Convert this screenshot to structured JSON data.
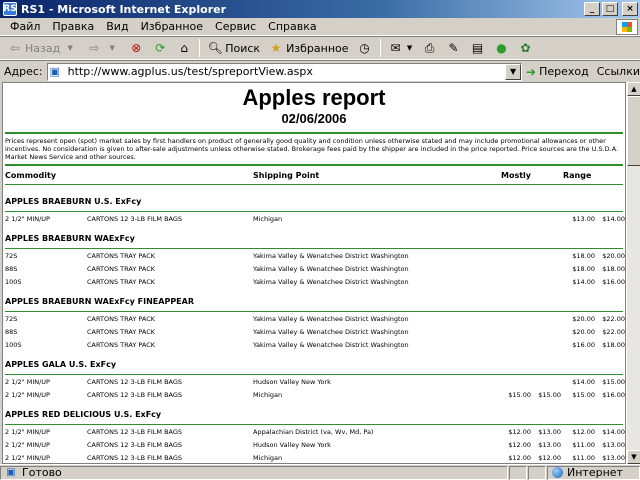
{
  "window": {
    "title": "RS1 - Microsoft Internet Explorer",
    "app_icon": "RS"
  },
  "menu": [
    "Файл",
    "Правка",
    "Вид",
    "Избранное",
    "Сервис",
    "Справка"
  ],
  "toolbar": {
    "back": "Назад",
    "search": "Поиск",
    "favorites": "Избранное"
  },
  "address": {
    "label": "Адрес:",
    "url": "http://www.agplus.us/test/spreportView.aspx",
    "go": "Переход",
    "links": "Ссылки"
  },
  "report": {
    "title": "Apples report",
    "date": "02/06/2006",
    "note": "Prices represent open (spot) market sales by first handlers on product of generally good quality and condition unless otherwise stated and may include promotional allowances or other incentives. No consideration is given to after-sale adjustments unless otherwise stated. Brokerage fees paid by the shipper are included in the price reported. Price sources are the U.S.D.A. Market News Service and other sources.",
    "headers": {
      "commodity": "Commodity",
      "shipping": "Shipping Point",
      "mostly": "Mostly",
      "range": "Range"
    },
    "sections": [
      {
        "title": "APPLES BRAEBURN U.S. ExFcy",
        "rows": [
          {
            "size": "2 1/2\" MIN/UP",
            "pack": "CARTONS 12 3-LB FILM BAGS",
            "ship": "Michigan",
            "m1": "",
            "m2": "",
            "r1": "$13.00",
            "r2": "$14.00"
          }
        ]
      },
      {
        "title": "APPLES BRAEBURN WAExFcy",
        "rows": [
          {
            "size": "72S",
            "pack": "CARTONS TRAY PACK",
            "ship": "Yakima Valley & Wenatchee District Washington",
            "m1": "",
            "m2": "",
            "r1": "$18.00",
            "r2": "$20.00"
          },
          {
            "size": "88S",
            "pack": "CARTONS TRAY PACK",
            "ship": "Yakima Valley & Wenatchee District Washington",
            "m1": "",
            "m2": "",
            "r1": "$18.00",
            "r2": "$18.00"
          },
          {
            "size": "100S",
            "pack": "CARTONS TRAY PACK",
            "ship": "Yakima Valley & Wenatchee District Washington",
            "m1": "",
            "m2": "",
            "r1": "$14.00",
            "r2": "$16.00"
          }
        ]
      },
      {
        "title": "APPLES BRAEBURN WAExFcy FINEAPPEAR",
        "rows": [
          {
            "size": "72S",
            "pack": "CARTONS TRAY PACK",
            "ship": "Yakima Valley & Wenatchee District Washington",
            "m1": "",
            "m2": "",
            "r1": "$20.00",
            "r2": "$22.00"
          },
          {
            "size": "88S",
            "pack": "CARTONS TRAY PACK",
            "ship": "Yakima Valley & Wenatchee District Washington",
            "m1": "",
            "m2": "",
            "r1": "$20.00",
            "r2": "$22.00"
          },
          {
            "size": "100S",
            "pack": "CARTONS TRAY PACK",
            "ship": "Yakima Valley & Wenatchee District Washington",
            "m1": "",
            "m2": "",
            "r1": "$16.00",
            "r2": "$18.00"
          }
        ]
      },
      {
        "title": "APPLES GALA U.S. ExFcy",
        "rows": [
          {
            "size": "2 1/2\" MIN/UP",
            "pack": "CARTONS 12 3-LB FILM BAGS",
            "ship": "Hudson Valley New York",
            "m1": "",
            "m2": "",
            "r1": "$14.00",
            "r2": "$15.00"
          },
          {
            "size": "2 1/2\" MIN/UP",
            "pack": "CARTONS 12 3-LB FILM BAGS",
            "ship": "Michigan",
            "m1": "$15.00",
            "m2": "$15.00",
            "r1": "$15.00",
            "r2": "$16.00"
          }
        ]
      },
      {
        "title": "APPLES RED DELICIOUS U.S. ExFcy",
        "rows": [
          {
            "size": "2 1/2\" MIN/UP",
            "pack": "CARTONS 12 3-LB FILM BAGS",
            "ship": "Appalachian District (va, Wv, Md, Pa)",
            "m1": "$12.00",
            "m2": "$13.00",
            "r1": "$12.00",
            "r2": "$14.00"
          },
          {
            "size": "2 1/2\" MIN/UP",
            "pack": "CARTONS 12 3-LB FILM BAGS",
            "ship": "Hudson Valley New York",
            "m1": "$12.00",
            "m2": "$13.00",
            "r1": "$11.00",
            "r2": "$13.00"
          },
          {
            "size": "2 1/2\" MIN/UP",
            "pack": "CARTONS 12 3-LB FILM BAGS",
            "ship": "Michigan",
            "m1": "$12.00",
            "m2": "$12.00",
            "r1": "$11.00",
            "r2": "$13.00"
          }
        ]
      }
    ]
  },
  "status": {
    "text": "Готово",
    "zone": "Интернет"
  },
  "colors": {
    "titlebar": "#0a246a",
    "rule": "#2f8f2f",
    "chrome": "#d4d0c8"
  }
}
